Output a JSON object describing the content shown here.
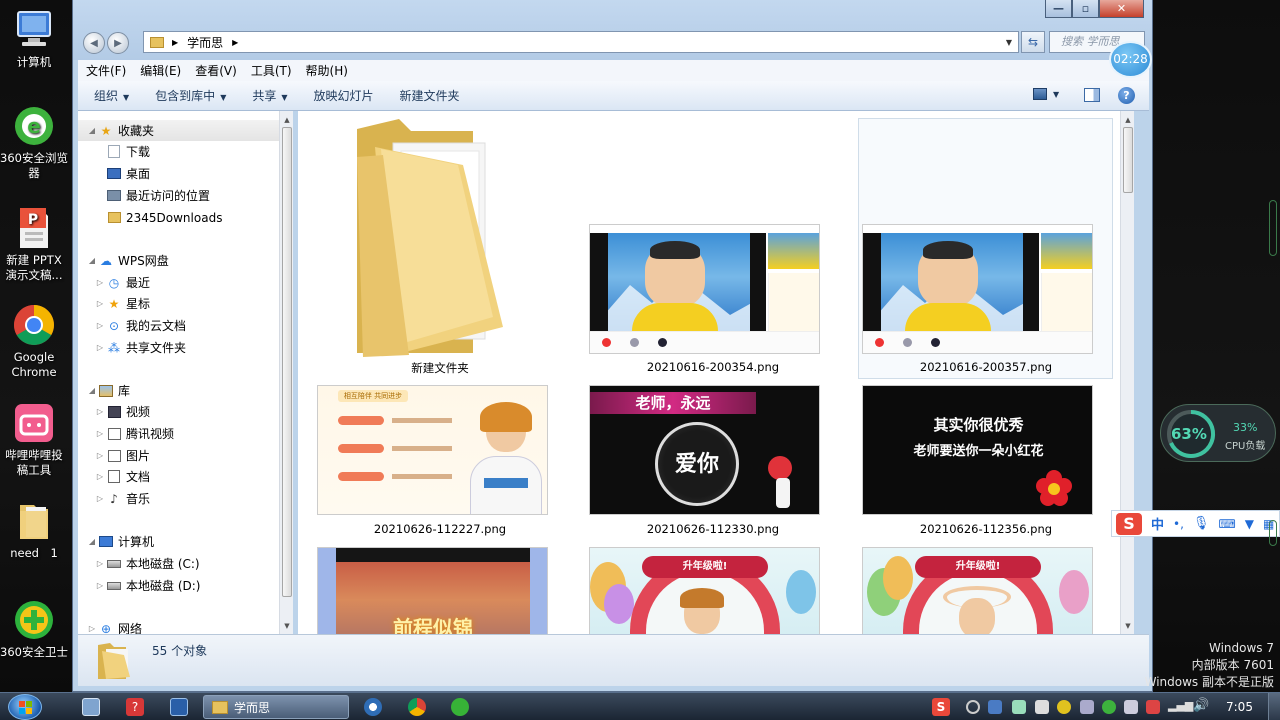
{
  "desktop": {
    "icons": [
      {
        "label": "计算机"
      },
      {
        "label": "360安全浏览器"
      },
      {
        "label": "新建 PPTX 演示文稿..."
      },
      {
        "label": "Google Chrome"
      },
      {
        "label": "哔哩哔哩投稿工具"
      },
      {
        "label": "need　1"
      },
      {
        "label": "360安全卫士"
      }
    ],
    "timer": "02:28",
    "cpu_widget": {
      "percent": "63%",
      "cpu_value": "33%",
      "cpu_label": "CPU负载"
    },
    "ime_bar": {
      "logo": "S",
      "lang": "中"
    },
    "watermark": {
      "line1": "Windows 7",
      "line2": "内部版本 7601",
      "line3": "Windows 副本不是正版"
    }
  },
  "window": {
    "address": {
      "crumb": "学而思"
    },
    "search_placeholder": "搜索 学而思",
    "menu": [
      "文件(F)",
      "编辑(E)",
      "查看(V)",
      "工具(T)",
      "帮助(H)"
    ],
    "toolbar": [
      "组织",
      "包含到库中",
      "共享",
      "放映幻灯片",
      "新建文件夹"
    ],
    "nav": {
      "favorites": "收藏夹",
      "downloads": "下载",
      "desktop": "桌面",
      "recent_places": "最近访问的位置",
      "downloads2345": "2345Downloads",
      "wps_drive": "WPS网盘",
      "wps_recent": "最近",
      "wps_starred": "星标",
      "wps_cloud_docs": "我的云文档",
      "wps_shared": "共享文件夹",
      "library": "库",
      "lib_video": "视频",
      "lib_tencent_video": "腾讯视频",
      "lib_pictures": "图片",
      "lib_docs": "文档",
      "lib_music": "音乐",
      "computer": "计算机",
      "disk_c": "本地磁盘 (C:)",
      "disk_d": "本地磁盘 (D:)",
      "network": "网络"
    },
    "files": [
      {
        "name": "新建文件夹",
        "thumb_text": ""
      },
      {
        "name": "20210616-200354.png",
        "thumb_text": ""
      },
      {
        "name": "20210616-200357.png",
        "thumb_text": ""
      },
      {
        "name": "20210626-112227.png",
        "thumb_text": "相互陪伴 共同进步"
      },
      {
        "name": "20210626-112330.png",
        "thumb_text": "老师，永远"
      },
      {
        "name": "20210626-112356.png",
        "thumb_text": "其实你很优秀"
      },
      {
        "name": "",
        "thumb_text": "前程似锦"
      },
      {
        "name": "",
        "thumb_text": "升年级啦!"
      },
      {
        "name": "",
        "thumb_text": "升年级啦!"
      }
    ],
    "thumb_texts": {
      "love_you": "爱你",
      "teacher_flower": "老师要送你一朵小红花"
    },
    "status": {
      "count": "55 个对象"
    }
  },
  "taskbar": {
    "active_task": "学而思",
    "clock": "7:05"
  }
}
